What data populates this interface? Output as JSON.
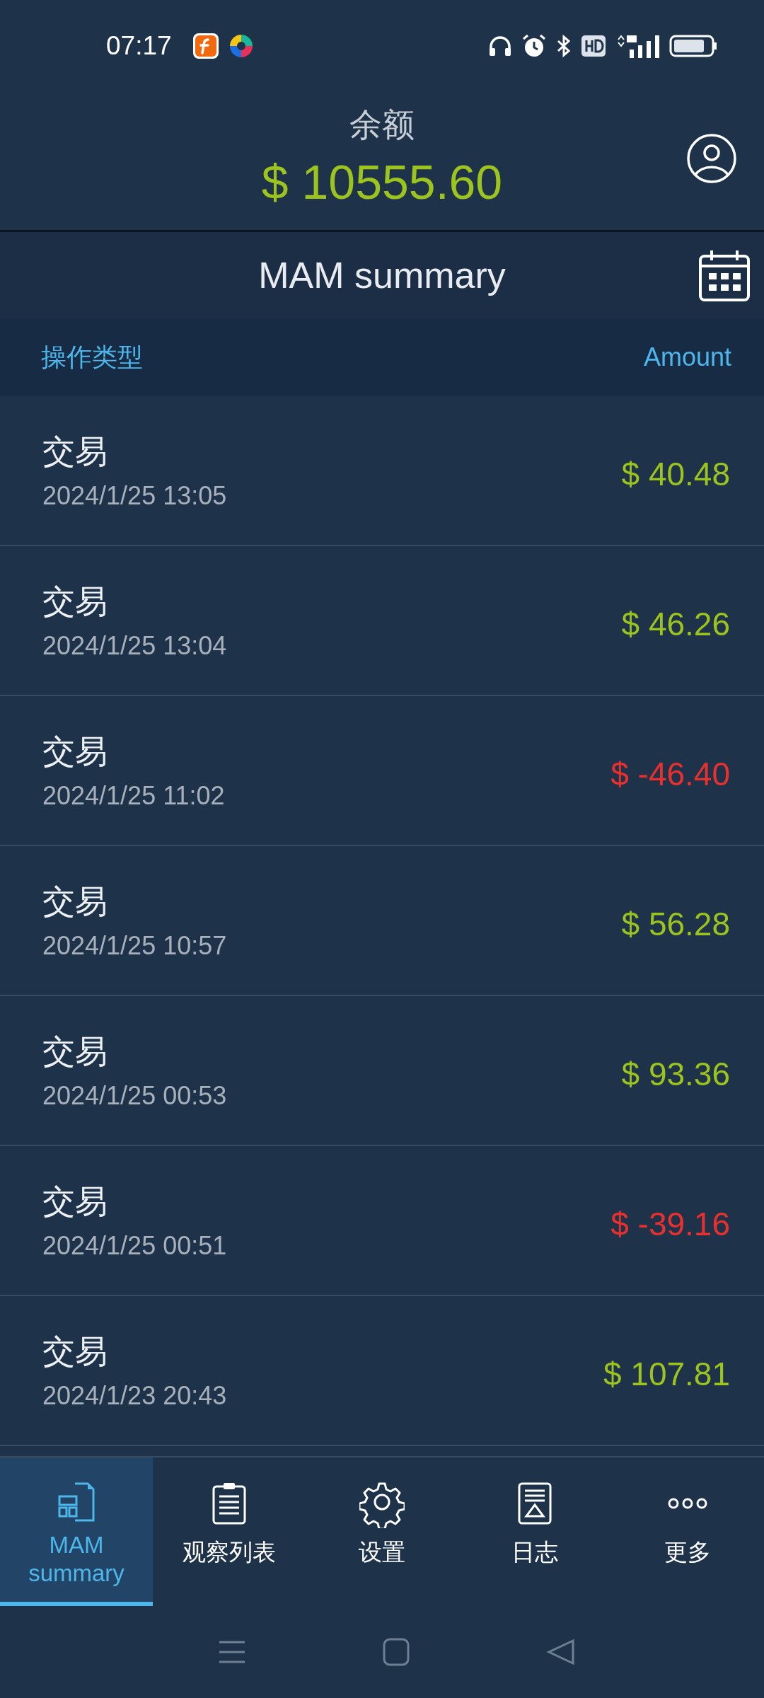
{
  "status_bar": {
    "time": "07:17"
  },
  "header": {
    "balance_label": "余额",
    "balance": "$ 10555.60"
  },
  "title_bar": {
    "title": "MAM summary"
  },
  "columns": [
    "操作类型",
    "Amount"
  ],
  "rows": [
    {
      "type": "交易",
      "date": "2024/1/25 13:05",
      "amount": "$ 40.48",
      "kind": "gain"
    },
    {
      "type": "交易",
      "date": "2024/1/25 13:04",
      "amount": "$ 46.26",
      "kind": "gain"
    },
    {
      "type": "交易",
      "date": "2024/1/25 11:02",
      "amount": "$ -46.40",
      "kind": "loss"
    },
    {
      "type": "交易",
      "date": "2024/1/25 10:57",
      "amount": "$ 56.28",
      "kind": "gain"
    },
    {
      "type": "交易",
      "date": "2024/1/25 00:53",
      "amount": "$ 93.36",
      "kind": "gain"
    },
    {
      "type": "交易",
      "date": "2024/1/25 00:51",
      "amount": "$ -39.16",
      "kind": "loss"
    },
    {
      "type": "交易",
      "date": "2024/1/23 20:43",
      "amount": "$ 107.81",
      "kind": "gain"
    }
  ],
  "tabs": [
    {
      "label": "MAM summary",
      "selected": true
    },
    {
      "label": "观察列表",
      "selected": false
    },
    {
      "label": "设置",
      "selected": false
    },
    {
      "label": "日志",
      "selected": false
    },
    {
      "label": "更多",
      "selected": false
    }
  ]
}
